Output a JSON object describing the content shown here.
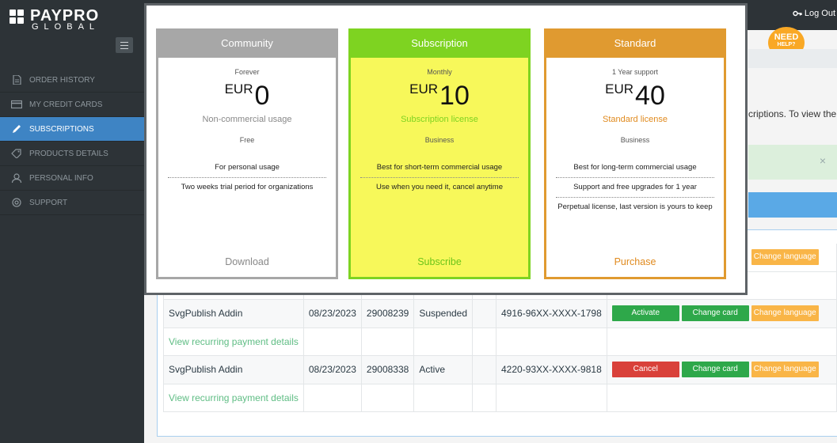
{
  "brand": {
    "name": "PAYPRO",
    "sub": "GLOBAL"
  },
  "topbar": {
    "logout_label": "Log Out"
  },
  "sidebar": {
    "items": [
      {
        "label": "ORDER HISTORY",
        "icon": "document-icon",
        "active": false
      },
      {
        "label": "MY CREDIT CARDS",
        "icon": "credit-card-icon",
        "active": false
      },
      {
        "label": "SUBSCRIPTIONS",
        "icon": "pencil-icon",
        "active": true
      },
      {
        "label": "PRODUCTS DETAILS",
        "icon": "tag-icon",
        "active": false
      },
      {
        "label": "PERSONAL INFO",
        "icon": "user-icon",
        "active": false
      },
      {
        "label": "SUPPORT",
        "icon": "support-icon",
        "active": false
      }
    ]
  },
  "help": {
    "line1": "NEED",
    "line2": "HELP?"
  },
  "background": {
    "intro_text": "criptions. To view the",
    "close_symbol": "×"
  },
  "table": {
    "top_row_button": "Change language",
    "rows": [
      {
        "product": "SvgPublish Addin",
        "date": "08/23/2023",
        "id": "29008239",
        "status": "Suspended",
        "card": "4916-96XX-XXXX-1798",
        "primary_action": "Activate",
        "change_card": "Change card",
        "change_language": "Change language",
        "details_link": "View recurring payment details"
      },
      {
        "product": "SvgPublish Addin",
        "date": "08/23/2023",
        "id": "29008338",
        "status": "Active",
        "card": "4220-93XX-XXXX-9818",
        "primary_action": "Cancel",
        "change_card": "Change card",
        "change_language": "Change language",
        "details_link": "View recurring payment details"
      }
    ]
  },
  "plans": [
    {
      "name": "Community",
      "period": "Forever",
      "currency": "EUR",
      "price": "0",
      "license": "Non-commercial usage",
      "usage": "Free",
      "features": [
        "For personal usage",
        "Two weeks trial period for organizations"
      ],
      "action": "Download",
      "head_color": "#a7a7a7",
      "border_color": "#a7a7a7",
      "body_color": "#ffffff",
      "license_color": "#888888",
      "action_color": "#888888"
    },
    {
      "name": "Subscription",
      "period": "Monthly",
      "currency": "EUR",
      "price": "10",
      "license": "Subscription license",
      "usage": "Business",
      "features": [
        "Best for short-term commercial usage",
        "Use when you need it, cancel anytime"
      ],
      "action": "Subscribe",
      "head_color": "#7ed321",
      "border_color": "#7ed321",
      "body_color": "#f7f85a",
      "license_color": "#7ed321",
      "action_color": "#6cc51a"
    },
    {
      "name": "Standard",
      "period": "1 Year support",
      "currency": "EUR",
      "price": "40",
      "license": "Standard license",
      "usage": "Business",
      "features": [
        "Best for long-term commercial usage",
        "Support and free upgrades for 1 year",
        "Perpetual license, last version is yours to keep"
      ],
      "action": "Purchase",
      "head_color": "#e09a30",
      "border_color": "#e09a30",
      "body_color": "#ffffff",
      "license_color": "#e08a1e",
      "action_color": "#e08a1e"
    }
  ]
}
